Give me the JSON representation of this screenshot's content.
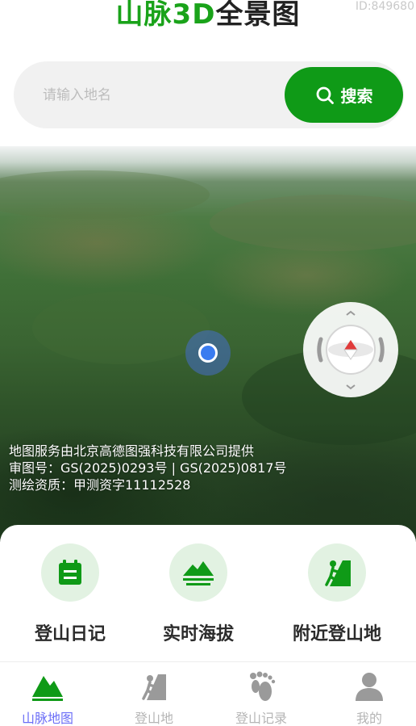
{
  "header": {
    "title_part1": "山脉3D",
    "title_part2": "全景图",
    "watermark": "ID:849680"
  },
  "search": {
    "placeholder": "请输入地名",
    "button_label": "搜索"
  },
  "map": {
    "attribution": [
      "地图服务由北京高德图强科技有限公司提供",
      "审图号：GS(2025)0293号 | GS(2025)0817号",
      "测绘资质：甲测资字11112528"
    ]
  },
  "features": [
    {
      "label": "登山日记",
      "icon": "calendar-icon"
    },
    {
      "label": "实时海拔",
      "icon": "mountain-altitude-icon"
    },
    {
      "label": "附近登山地",
      "icon": "climber-icon"
    }
  ],
  "tabbar": {
    "tabs": [
      {
        "label": "山脉地图",
        "icon": "mountain-icon",
        "active": true
      },
      {
        "label": "登山地",
        "icon": "climber-icon",
        "active": false
      },
      {
        "label": "登山记录",
        "icon": "footprint-icon",
        "active": false
      },
      {
        "label": "我的",
        "icon": "user-icon",
        "active": false
      }
    ]
  },
  "colors": {
    "brand_green": "#0f9a17",
    "tab_active": "#6b6ef7",
    "tab_inactive": "#b5b5b5",
    "feature_bg": "#e2f2e2"
  }
}
